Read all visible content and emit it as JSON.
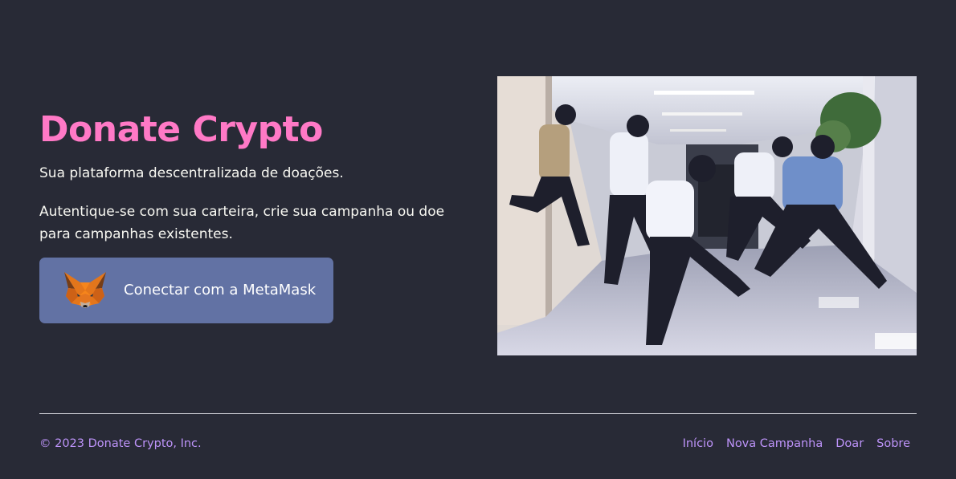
{
  "hero": {
    "title": "Donate Crypto",
    "subtitle": "Sua plataforma descentralizada de doações.",
    "description": "Autentique-se com sua carteira, crie sua campanha ou doe para campanhas existentes.",
    "cta": {
      "label": "Conectar com a MetaMask",
      "icon": "metamask-fox-icon"
    },
    "image": {
      "alt": "Group of people jumping in a hallway",
      "icon": "hero-photo"
    }
  },
  "footer": {
    "copyright": "© 2023 Donate Crypto, Inc.",
    "links": [
      "Início",
      "Nova Campanha",
      "Doar",
      "Sobre"
    ]
  },
  "colors": {
    "background": "#282a36",
    "title": "#ff79c6",
    "text": "#f8f8f2",
    "button": "#6272a4",
    "link": "#bd93f9",
    "divider": "#c8c8d0"
  }
}
